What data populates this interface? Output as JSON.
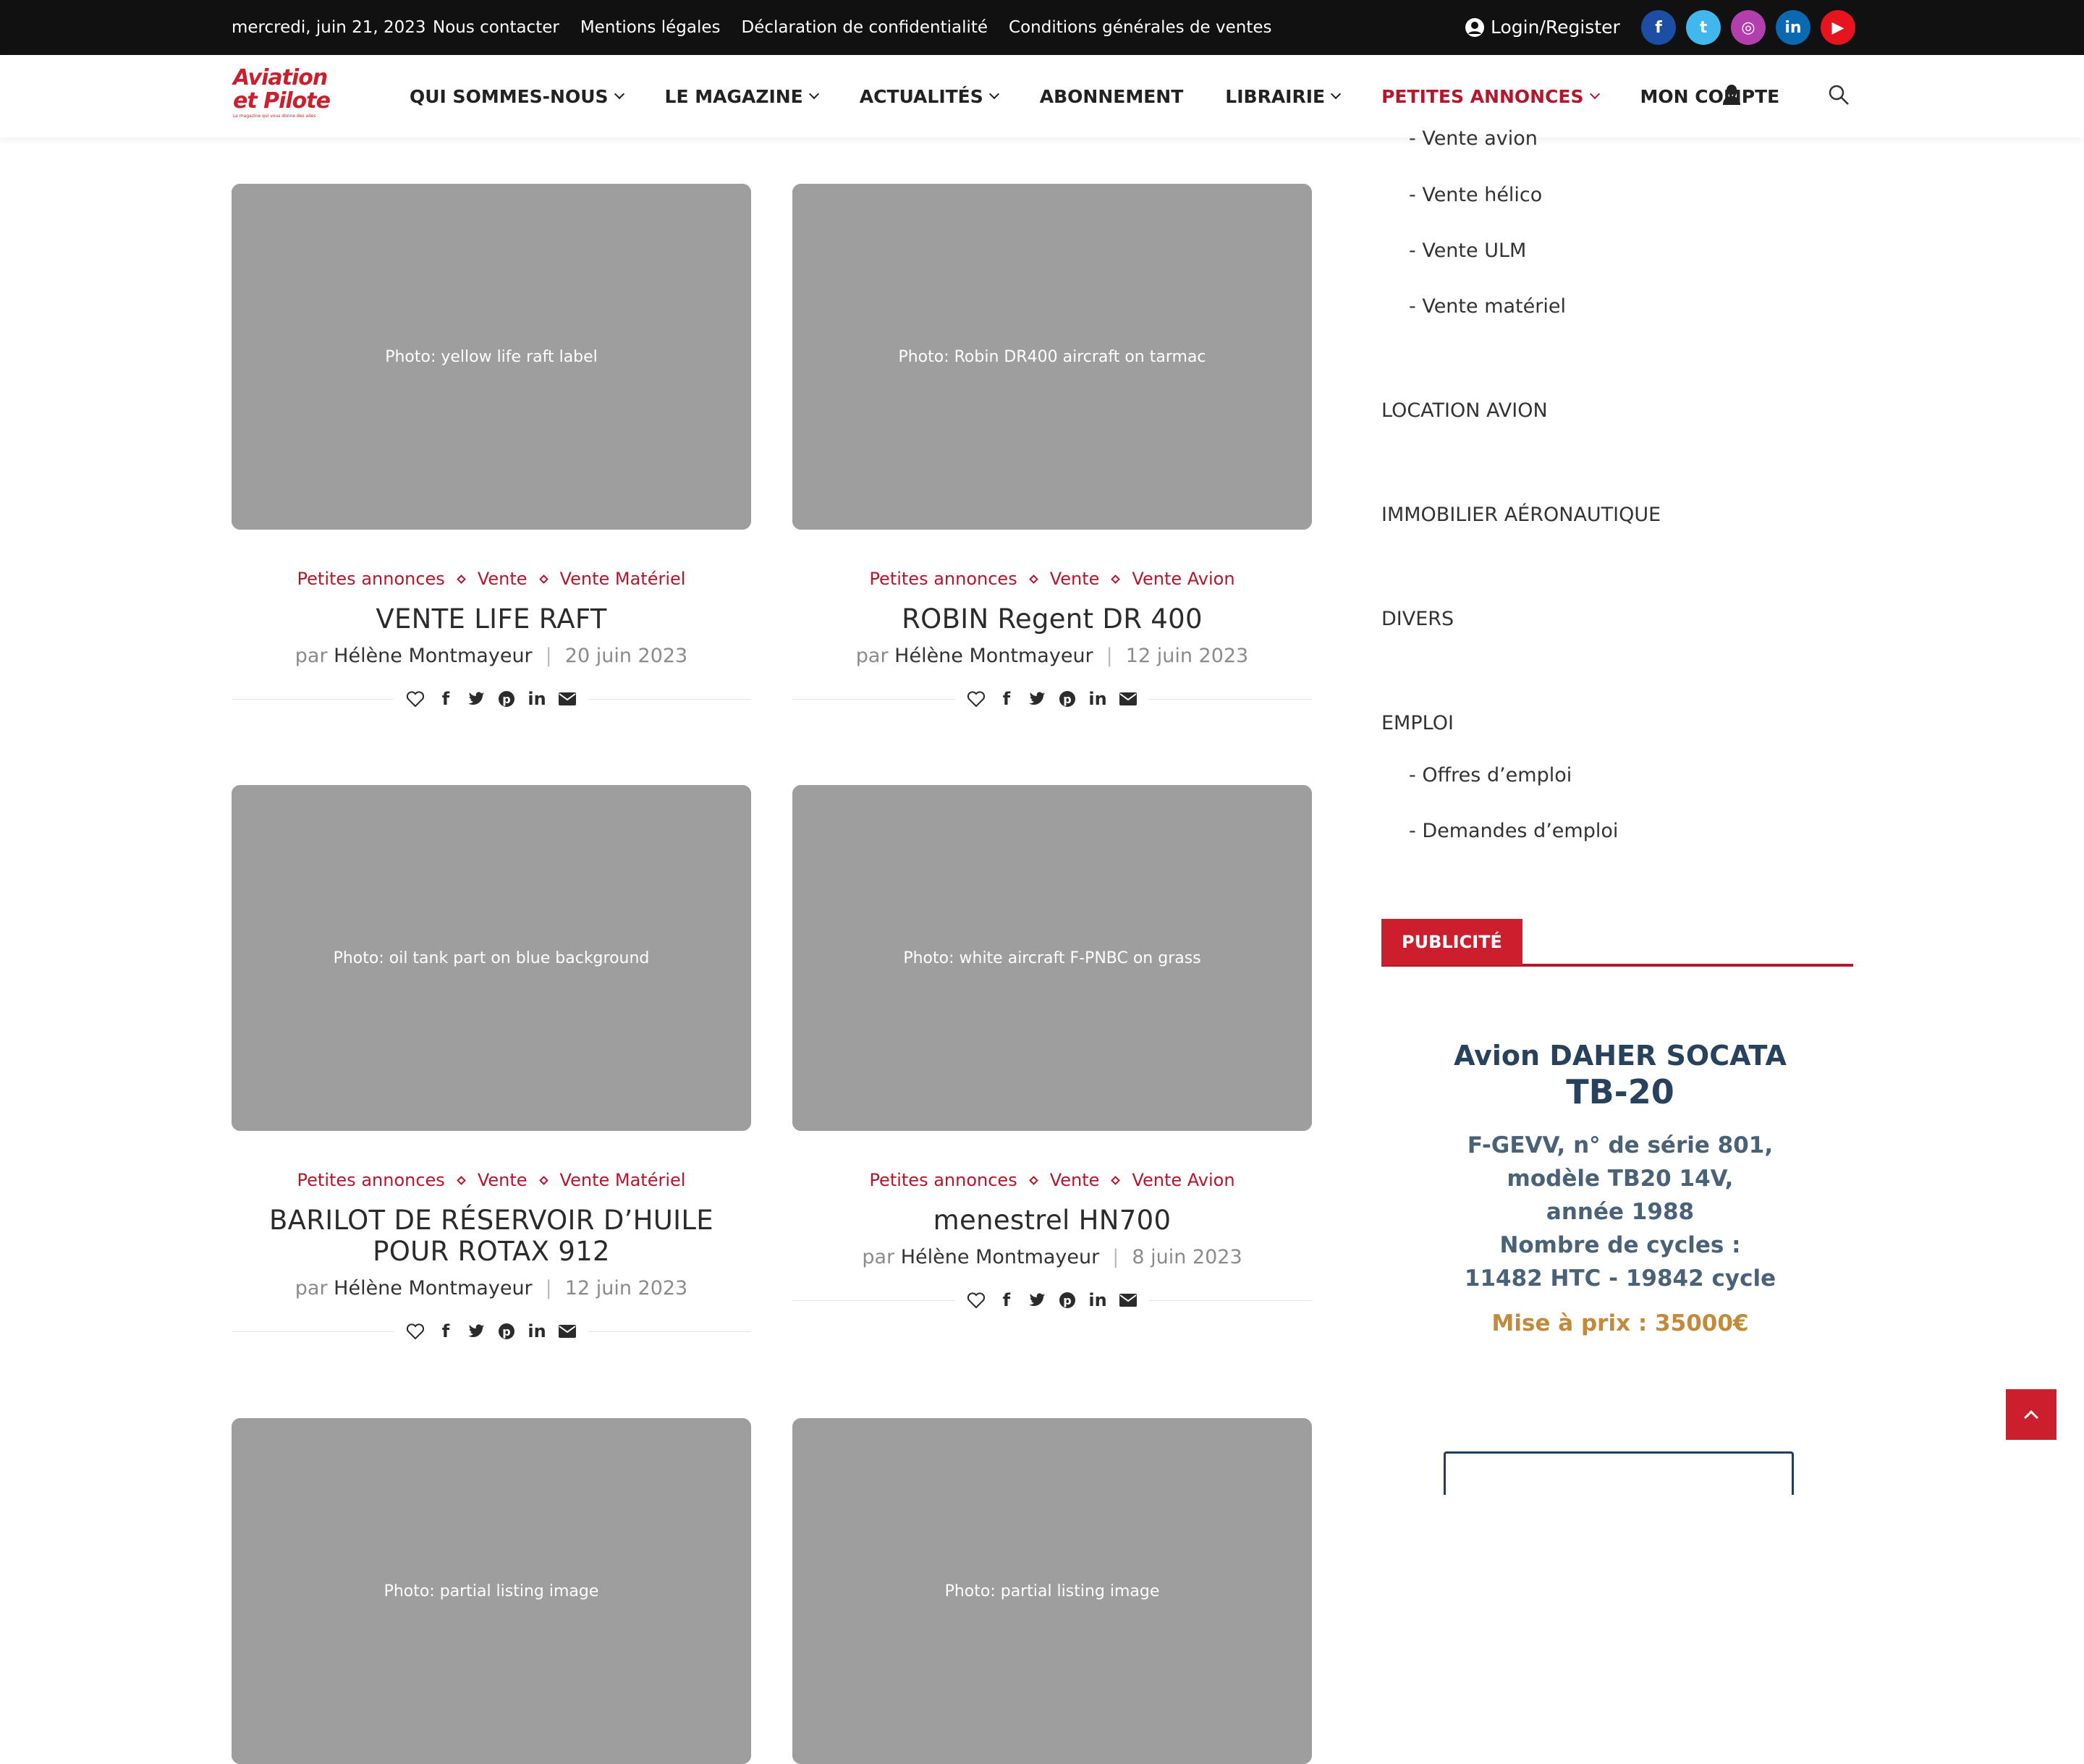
{
  "topbar": {
    "date": "mercredi, juin 21, 2023",
    "links": [
      "Nous contacter",
      "Mentions légales",
      "Déclaration de confidentialité",
      "Conditions générales de ventes"
    ],
    "login": "Login/Register",
    "socials": [
      {
        "icon": "facebook-icon",
        "glyph": "f",
        "color": "#1c4fa3"
      },
      {
        "icon": "twitter-icon",
        "glyph": "t",
        "color": "#42b7ee"
      },
      {
        "icon": "instagram-icon",
        "glyph": "◎",
        "color": "#b33fae"
      },
      {
        "icon": "linkedin-icon",
        "glyph": "in",
        "color": "#0a69b0"
      },
      {
        "icon": "youtube-icon",
        "glyph": "▶",
        "color": "#e5141e"
      }
    ]
  },
  "nav": {
    "logo_line1": "Aviation",
    "logo_line2": "et Pilote",
    "logo_tagline": "Le magazine qui vous donne des ailes",
    "items": [
      {
        "label": "QUI SOMMES-NOUS",
        "dropdown": true
      },
      {
        "label": "LE MAGAZINE",
        "dropdown": true
      },
      {
        "label": "ACTUALITÉS",
        "dropdown": true
      },
      {
        "label": "ABONNEMENT",
        "dropdown": false
      },
      {
        "label": "LIBRAIRIE",
        "dropdown": true
      },
      {
        "label": "PETITES ANNONCES",
        "dropdown": true,
        "active": true
      },
      {
        "label": "MON COMPTE",
        "dropdown": false
      }
    ],
    "accent": "#b5162c"
  },
  "posts": [
    {
      "image": "Photo: yellow life raft label",
      "cats": [
        "Petites annonces",
        "Vente",
        "Vente Matériel"
      ],
      "title": "VENTE LIFE RAFT",
      "by": "par",
      "author": "Hélène Montmayeur",
      "date": "20 juin 2023"
    },
    {
      "image": "Photo: Robin DR400 aircraft on tarmac",
      "cats": [
        "Petites annonces",
        "Vente",
        "Vente Avion"
      ],
      "title": "ROBIN Regent DR 400",
      "by": "par",
      "author": "Hélène Montmayeur",
      "date": "12 juin 2023"
    },
    {
      "image": "Photo: oil tank part on blue background",
      "cats": [
        "Petites annonces",
        "Vente",
        "Vente Matériel"
      ],
      "title": "BARILOT DE RÉSERVOIR D’HUILE POUR ROTAX 912",
      "by": "par",
      "author": "Hélène Montmayeur",
      "date": "12 juin 2023"
    },
    {
      "image": "Photo: white aircraft F-PNBC on grass",
      "cats": [
        "Petites annonces",
        "Vente",
        "Vente Avion"
      ],
      "title": "menestrel HN700",
      "by": "par",
      "author": "Hélène Montmayeur",
      "date": "8 juin 2023"
    },
    {
      "image": "Photo: partial listing image"
    },
    {
      "image": "Photo: partial listing image"
    }
  ],
  "sidebar": {
    "vente_items": [
      "- Vente avion",
      "- Vente hélico",
      "- Vente ULM",
      "- Vente matériel"
    ],
    "headings": [
      "LOCATION AVION",
      "IMMOBILIER AÉRONAUTIQUE",
      "DIVERS",
      "EMPLOI"
    ],
    "emploi_items": [
      "- Offres d’emploi",
      "- Demandes d’emploi"
    ],
    "pub_title": "PUBLICITÉ",
    "ad": {
      "line1": "Avion DAHER SOCATA",
      "line2": "TB-20",
      "line3": "F-GEVV, n° de série 801,",
      "line4": "modèle TB20 14V,",
      "line5": "année 1988",
      "line6": "Nombre de cycles :",
      "line7": "11482 HTC - 19842 cycle",
      "line8": "Mise à prix : 35000€"
    }
  }
}
